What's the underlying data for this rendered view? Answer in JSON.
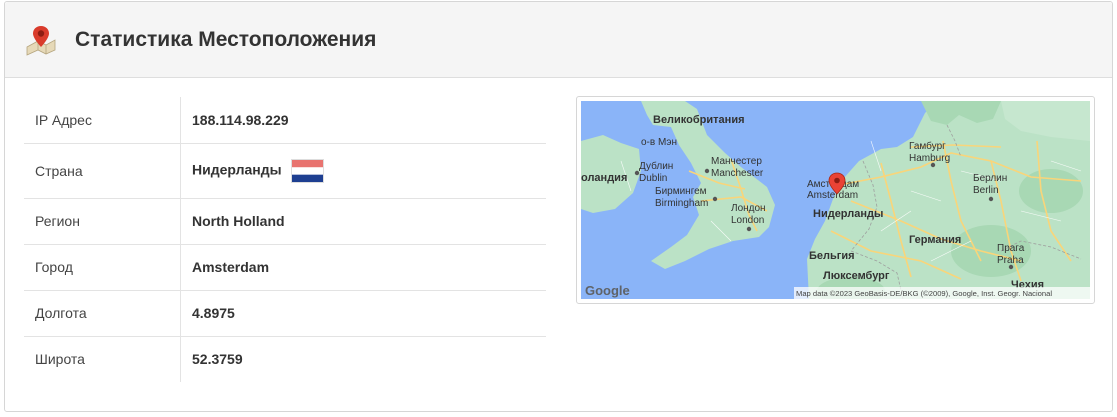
{
  "panel": {
    "title": "Статистика Местоположения",
    "header_icon": "map-pin-icon"
  },
  "info": {
    "rows": [
      {
        "label": "IP Адрес",
        "value": "188.114.98.229"
      },
      {
        "label": "Страна",
        "value": "Нидерланды",
        "flag": "nl-flag-icon"
      },
      {
        "label": "Регион",
        "value": "North Holland"
      },
      {
        "label": "Город",
        "value": "Amsterdam"
      },
      {
        "label": "Долгота",
        "value": "4.8975"
      },
      {
        "label": "Широта",
        "value": "52.3759"
      }
    ]
  },
  "map": {
    "labels": {
      "uk": "Великобритания",
      "isle_of_man": "о-в Мэн",
      "dublin_ru": "Дублин",
      "dublin_en": "Dublin",
      "ireland": "оландия",
      "manchester_ru": "Манчестер",
      "manchester_en": "Manchester",
      "birmingham_ru": "Бирмингем",
      "birmingham_en": "Birmingham",
      "london_ru": "Лондон",
      "london_en": "London",
      "amsterdam_ru": "Амстердам",
      "amsterdam_en": "Amsterdam",
      "netherlands": "Нидерланды",
      "hamburg_ru": "Гамбург",
      "hamburg_en": "Hamburg",
      "berlin_ru": "Берлин",
      "berlin_en": "Berlin",
      "germany": "Германия",
      "belgium": "Бельгия",
      "luxembourg": "Люксембург",
      "prague_ru": "Прага",
      "prague_en": "Praha",
      "czech": "Чехия"
    },
    "google_logo": "Google",
    "attribution": "Map data ©2023 GeoBasis-DE/BKG (©2009), Google, Inst. Geogr. Nacional",
    "colors": {
      "water": "#8ab4f8",
      "land": "#bbe2c6",
      "land_alt": "#a8d8b4",
      "roads": "#f9d57a",
      "marker": "#ea4335"
    }
  }
}
